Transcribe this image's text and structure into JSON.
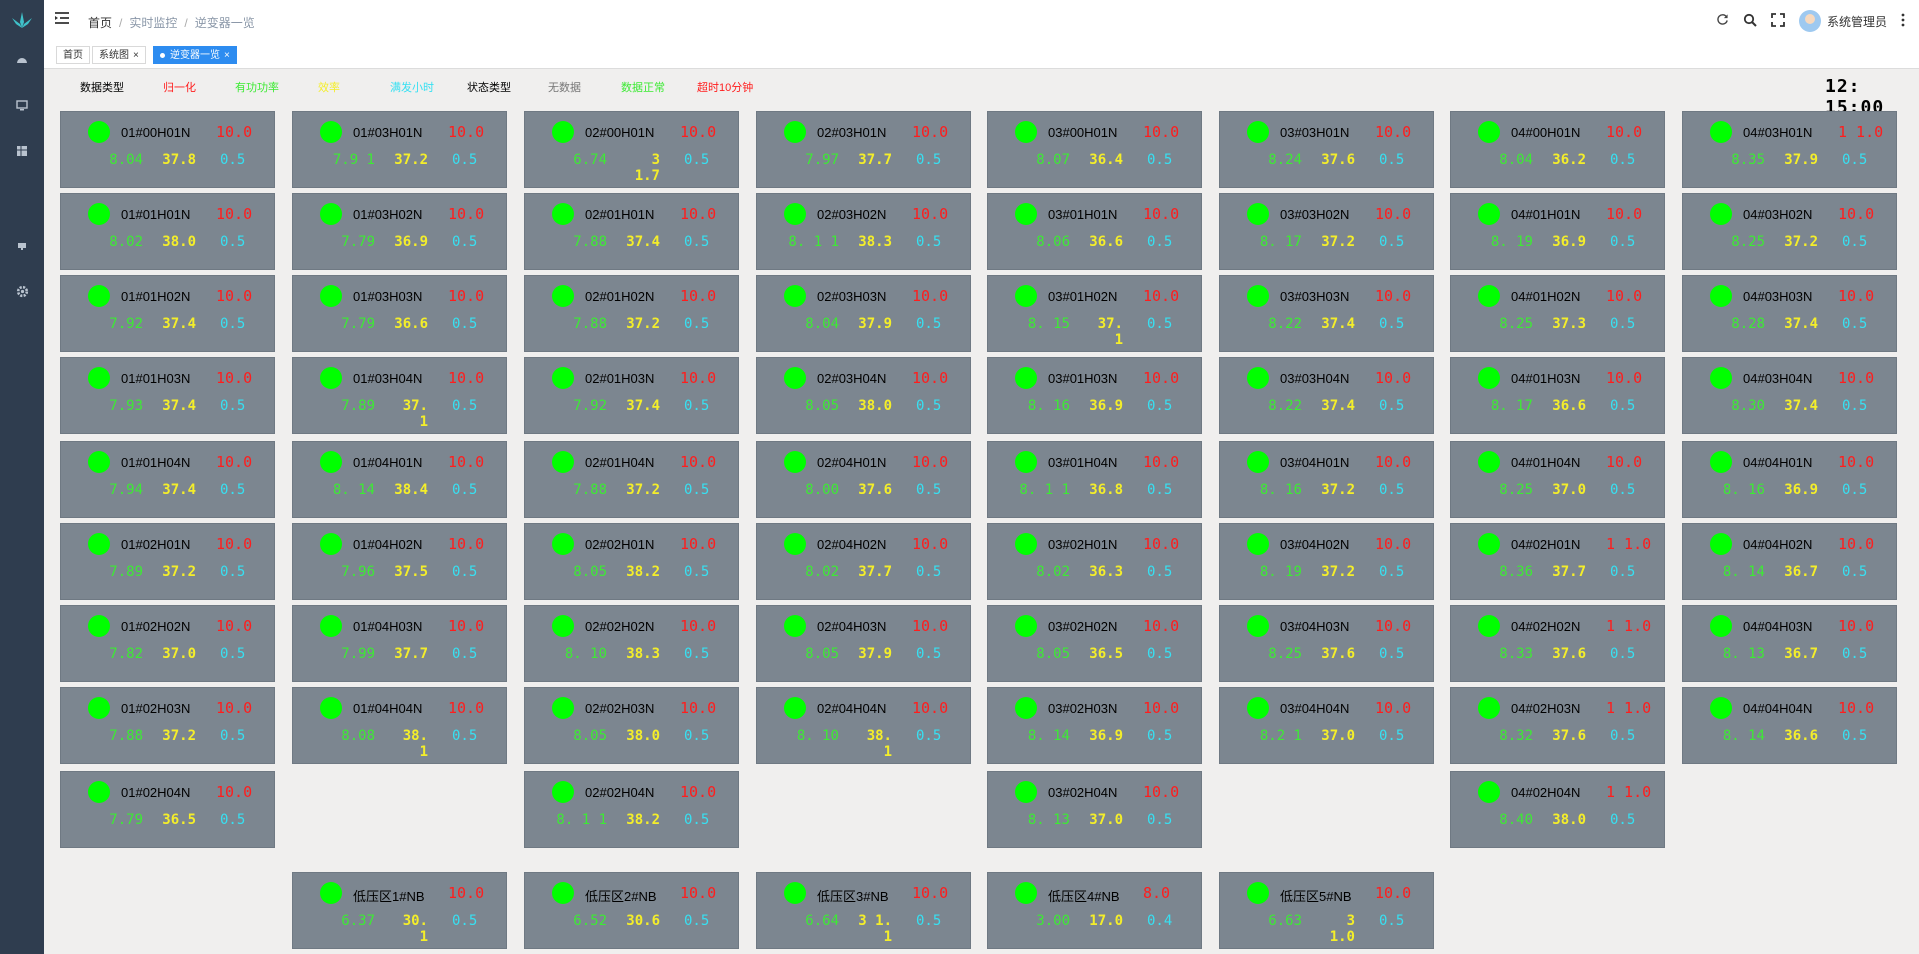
{
  "header": {
    "breadcrumb": [
      "首页",
      "实时监控",
      "逆变器一览"
    ],
    "user_name": "系统管理员"
  },
  "tabs": [
    {
      "label": "首页"
    },
    {
      "label": "系统图"
    },
    {
      "label": "逆变器一览"
    }
  ],
  "legend": {
    "data_type_label": "数据类型",
    "normalized": "归一化",
    "active_power": "有功功率",
    "efficiency": "效率",
    "full_hours": "满发小时",
    "status_type_label": "状态类型",
    "no_data": "无数据",
    "data_normal": "数据正常",
    "timeout": "超时10分钟"
  },
  "colors": {
    "normalized": "#ff1d1d",
    "active_power": "#3dea34",
    "efficiency": "#f4ee2a",
    "full_hours": "#37e0f2",
    "no_data": "#777777",
    "data_normal": "#3dea34",
    "timeout": "#ff1d1d",
    "status_ok": "#00ff00",
    "card_bg": "#7c8690"
  },
  "clock": "12: 15:00",
  "inverters": [
    {
      "name": "01#00H01N",
      "norm": "10.0",
      "v1": "8.04",
      "v2": "37.8",
      "v3": "0.5",
      "status": "ok"
    },
    {
      "name": "01#03H01N",
      "norm": "10.0",
      "v1": "7.9 1",
      "v2": "37.2",
      "v3": "0.5",
      "status": "ok"
    },
    {
      "name": "02#00H01N",
      "norm": "10.0",
      "v1": "6.74",
      "v2": "3 1.7",
      "v3": "0.5",
      "status": "ok"
    },
    {
      "name": "02#03H01N",
      "norm": "10.0",
      "v1": "7.97",
      "v2": "37.7",
      "v3": "0.5",
      "status": "ok"
    },
    {
      "name": "03#00H01N",
      "norm": "10.0",
      "v1": "8.07",
      "v2": "36.4",
      "v3": "0.5",
      "status": "ok"
    },
    {
      "name": "03#03H01N",
      "norm": "10.0",
      "v1": "8.24",
      "v2": "37.6",
      "v3": "0.5",
      "status": "ok"
    },
    {
      "name": "04#00H01N",
      "norm": "10.0",
      "v1": "8.04",
      "v2": "36.2",
      "v3": "0.5",
      "status": "ok"
    },
    {
      "name": "04#03H01N",
      "norm": "1 1.0",
      "v1": "8.35",
      "v2": "37.9",
      "v3": "0.5",
      "status": "ok"
    },
    {
      "name": "01#01H01N",
      "norm": "10.0",
      "v1": "8.02",
      "v2": "38.0",
      "v3": "0.5",
      "status": "ok"
    },
    {
      "name": "01#03H02N",
      "norm": "10.0",
      "v1": "7.79",
      "v2": "36.9",
      "v3": "0.5",
      "status": "ok"
    },
    {
      "name": "02#01H01N",
      "norm": "10.0",
      "v1": "7.88",
      "v2": "37.4",
      "v3": "0.5",
      "status": "ok"
    },
    {
      "name": "02#03H02N",
      "norm": "10.0",
      "v1": "8. 1 1",
      "v2": "38.3",
      "v3": "0.5",
      "status": "ok"
    },
    {
      "name": "03#01H01N",
      "norm": "10.0",
      "v1": "8.06",
      "v2": "36.6",
      "v3": "0.5",
      "status": "ok"
    },
    {
      "name": "03#03H02N",
      "norm": "10.0",
      "v1": "8. 17",
      "v2": "37.2",
      "v3": "0.5",
      "status": "ok"
    },
    {
      "name": "04#01H01N",
      "norm": "10.0",
      "v1": "8. 19",
      "v2": "36.9",
      "v3": "0.5",
      "status": "ok"
    },
    {
      "name": "04#03H02N",
      "norm": "10.0",
      "v1": "8.25",
      "v2": "37.2",
      "v3": "0.5",
      "status": "ok"
    },
    {
      "name": "01#01H02N",
      "norm": "10.0",
      "v1": "7.92",
      "v2": "37.4",
      "v3": "0.5",
      "status": "ok"
    },
    {
      "name": "01#03H03N",
      "norm": "10.0",
      "v1": "7.79",
      "v2": "36.6",
      "v3": "0.5",
      "status": "ok"
    },
    {
      "name": "02#01H02N",
      "norm": "10.0",
      "v1": "7.88",
      "v2": "37.2",
      "v3": "0.5",
      "status": "ok"
    },
    {
      "name": "02#03H03N",
      "norm": "10.0",
      "v1": "8.04",
      "v2": "37.9",
      "v3": "0.5",
      "status": "ok"
    },
    {
      "name": "03#01H02N",
      "norm": "10.0",
      "v1": "8. 15",
      "v2": "37. 1",
      "v3": "0.5",
      "status": "ok"
    },
    {
      "name": "03#03H03N",
      "norm": "10.0",
      "v1": "8.22",
      "v2": "37.4",
      "v3": "0.5",
      "status": "ok"
    },
    {
      "name": "04#01H02N",
      "norm": "10.0",
      "v1": "8.25",
      "v2": "37.3",
      "v3": "0.5",
      "status": "ok"
    },
    {
      "name": "04#03H03N",
      "norm": "10.0",
      "v1": "8.28",
      "v2": "37.4",
      "v3": "0.5",
      "status": "ok"
    },
    {
      "name": "01#01H03N",
      "norm": "10.0",
      "v1": "7.93",
      "v2": "37.4",
      "v3": "0.5",
      "status": "ok"
    },
    {
      "name": "01#03H04N",
      "norm": "10.0",
      "v1": "7.89",
      "v2": "37. 1",
      "v3": "0.5",
      "status": "ok"
    },
    {
      "name": "02#01H03N",
      "norm": "10.0",
      "v1": "7.92",
      "v2": "37.4",
      "v3": "0.5",
      "status": "ok"
    },
    {
      "name": "02#03H04N",
      "norm": "10.0",
      "v1": "8.05",
      "v2": "38.0",
      "v3": "0.5",
      "status": "ok"
    },
    {
      "name": "03#01H03N",
      "norm": "10.0",
      "v1": "8. 16",
      "v2": "36.9",
      "v3": "0.5",
      "status": "ok"
    },
    {
      "name": "03#03H04N",
      "norm": "10.0",
      "v1": "8.22",
      "v2": "37.4",
      "v3": "0.5",
      "status": "ok"
    },
    {
      "name": "04#01H03N",
      "norm": "10.0",
      "v1": "8. 17",
      "v2": "36.6",
      "v3": "0.5",
      "status": "ok"
    },
    {
      "name": "04#03H04N",
      "norm": "10.0",
      "v1": "8.30",
      "v2": "37.4",
      "v3": "0.5",
      "status": "ok"
    },
    {
      "name": "01#01H04N",
      "norm": "10.0",
      "v1": "7.94",
      "v2": "37.4",
      "v3": "0.5",
      "status": "ok"
    },
    {
      "name": "01#04H01N",
      "norm": "10.0",
      "v1": "8. 14",
      "v2": "38.4",
      "v3": "0.5",
      "status": "ok"
    },
    {
      "name": "02#01H04N",
      "norm": "10.0",
      "v1": "7.88",
      "v2": "37.2",
      "v3": "0.5",
      "status": "ok"
    },
    {
      "name": "02#04H01N",
      "norm": "10.0",
      "v1": "8.00",
      "v2": "37.6",
      "v3": "0.5",
      "status": "ok"
    },
    {
      "name": "03#01H04N",
      "norm": "10.0",
      "v1": "8. 1 1",
      "v2": "36.8",
      "v3": "0.5",
      "status": "ok"
    },
    {
      "name": "03#04H01N",
      "norm": "10.0",
      "v1": "8. 16",
      "v2": "37.2",
      "v3": "0.5",
      "status": "ok"
    },
    {
      "name": "04#01H04N",
      "norm": "10.0",
      "v1": "8.25",
      "v2": "37.0",
      "v3": "0.5",
      "status": "ok"
    },
    {
      "name": "04#04H01N",
      "norm": "10.0",
      "v1": "8. 16",
      "v2": "36.9",
      "v3": "0.5",
      "status": "ok"
    },
    {
      "name": "01#02H01N",
      "norm": "10.0",
      "v1": "7.89",
      "v2": "37.2",
      "v3": "0.5",
      "status": "ok"
    },
    {
      "name": "01#04H02N",
      "norm": "10.0",
      "v1": "7.96",
      "v2": "37.5",
      "v3": "0.5",
      "status": "ok"
    },
    {
      "name": "02#02H01N",
      "norm": "10.0",
      "v1": "8.05",
      "v2": "38.2",
      "v3": "0.5",
      "status": "ok"
    },
    {
      "name": "02#04H02N",
      "norm": "10.0",
      "v1": "8.02",
      "v2": "37.7",
      "v3": "0.5",
      "status": "ok"
    },
    {
      "name": "03#02H01N",
      "norm": "10.0",
      "v1": "8.02",
      "v2": "36.3",
      "v3": "0.5",
      "status": "ok"
    },
    {
      "name": "03#04H02N",
      "norm": "10.0",
      "v1": "8. 19",
      "v2": "37.2",
      "v3": "0.5",
      "status": "ok"
    },
    {
      "name": "04#02H01N",
      "norm": "1 1.0",
      "v1": "8.36",
      "v2": "37.7",
      "v3": "0.5",
      "status": "ok"
    },
    {
      "name": "04#04H02N",
      "norm": "10.0",
      "v1": "8. 14",
      "v2": "36.7",
      "v3": "0.5",
      "status": "ok"
    },
    {
      "name": "01#02H02N",
      "norm": "10.0",
      "v1": "7.82",
      "v2": "37.0",
      "v3": "0.5",
      "status": "ok"
    },
    {
      "name": "01#04H03N",
      "norm": "10.0",
      "v1": "7.99",
      "v2": "37.7",
      "v3": "0.5",
      "status": "ok"
    },
    {
      "name": "02#02H02N",
      "norm": "10.0",
      "v1": "8. 10",
      "v2": "38.3",
      "v3": "0.5",
      "status": "ok"
    },
    {
      "name": "02#04H03N",
      "norm": "10.0",
      "v1": "8.05",
      "v2": "37.9",
      "v3": "0.5",
      "status": "ok"
    },
    {
      "name": "03#02H02N",
      "norm": "10.0",
      "v1": "8.05",
      "v2": "36.5",
      "v3": "0.5",
      "status": "ok"
    },
    {
      "name": "03#04H03N",
      "norm": "10.0",
      "v1": "8.25",
      "v2": "37.6",
      "v3": "0.5",
      "status": "ok"
    },
    {
      "name": "04#02H02N",
      "norm": "1 1.0",
      "v1": "8.33",
      "v2": "37.6",
      "v3": "0.5",
      "status": "ok"
    },
    {
      "name": "04#04H03N",
      "norm": "10.0",
      "v1": "8. 13",
      "v2": "36.7",
      "v3": "0.5",
      "status": "ok"
    },
    {
      "name": "01#02H03N",
      "norm": "10.0",
      "v1": "7.88",
      "v2": "37.2",
      "v3": "0.5",
      "status": "ok"
    },
    {
      "name": "01#04H04N",
      "norm": "10.0",
      "v1": "8.08",
      "v2": "38. 1",
      "v3": "0.5",
      "status": "ok"
    },
    {
      "name": "02#02H03N",
      "norm": "10.0",
      "v1": "8.05",
      "v2": "38.0",
      "v3": "0.5",
      "status": "ok"
    },
    {
      "name": "02#04H04N",
      "norm": "10.0",
      "v1": "8. 10",
      "v2": "38. 1",
      "v3": "0.5",
      "status": "ok"
    },
    {
      "name": "03#02H03N",
      "norm": "10.0",
      "v1": "8. 14",
      "v2": "36.9",
      "v3": "0.5",
      "status": "ok"
    },
    {
      "name": "03#04H04N",
      "norm": "10.0",
      "v1": "8.2 1",
      "v2": "37.0",
      "v3": "0.5",
      "status": "ok"
    },
    {
      "name": "04#02H03N",
      "norm": "1 1.0",
      "v1": "8.32",
      "v2": "37.6",
      "v3": "0.5",
      "status": "ok"
    },
    {
      "name": "04#04H04N",
      "norm": "10.0",
      "v1": "8. 14",
      "v2": "36.6",
      "v3": "0.5",
      "status": "ok"
    },
    {
      "name": "01#02H04N",
      "norm": "10.0",
      "v1": "7.79",
      "v2": "36.5",
      "v3": "0.5",
      "status": "ok"
    },
    {
      "name": "02#02H04N",
      "norm": "10.0",
      "v1": "8. 1 1",
      "v2": "38.2",
      "v3": "0.5",
      "status": "ok"
    },
    {
      "name": "03#02H04N",
      "norm": "10.0",
      "v1": "8. 13",
      "v2": "37.0",
      "v3": "0.5",
      "status": "ok"
    },
    {
      "name": "04#02H04N",
      "norm": "1 1.0",
      "v1": "8.40",
      "v2": "38.0",
      "v3": "0.5",
      "status": "ok"
    },
    {
      "name": "低压区1#NB",
      "norm": "10.0",
      "v1": "6.37",
      "v2": "30. 1",
      "v3": "0.5",
      "status": "ok"
    },
    {
      "name": "低压区2#NB",
      "norm": "10.0",
      "v1": "6.52",
      "v2": "30.6",
      "v3": "0.5",
      "status": "ok"
    },
    {
      "name": "低压区3#NB",
      "norm": "10.0",
      "v1": "6.64",
      "v2": "3 1. 1",
      "v3": "0.5",
      "status": "ok"
    },
    {
      "name": "低压区4#NB",
      "norm": "8.0",
      "v1": "3.00",
      "v2": "17.0",
      "v3": "0.4",
      "status": "ok"
    },
    {
      "name": "低压区5#NB",
      "norm": "10.0",
      "v1": "6.63",
      "v2": "3 1.0",
      "v3": "0.5",
      "status": "ok"
    }
  ]
}
